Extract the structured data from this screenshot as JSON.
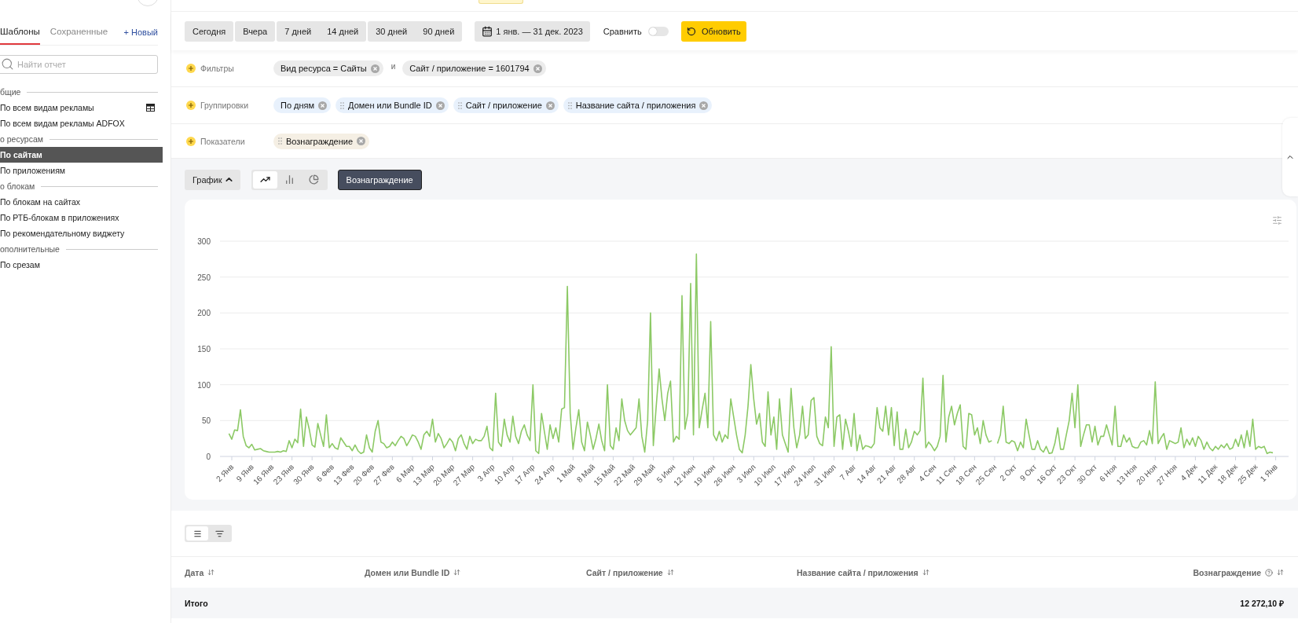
{
  "sidebar": {
    "tabs": [
      {
        "label": "Шаблоны",
        "selected": true
      },
      {
        "label": "Сохраненные",
        "selected": false
      }
    ],
    "new_button": "+ Новый",
    "search": {
      "placeholder": "Найти отчет"
    },
    "sections": [
      {
        "title": "бщие",
        "items": [
          {
            "label": "По всем видам рекламы",
            "selected": false,
            "has_icon": true
          },
          {
            "label": "По всем видам рекламы ADFOX",
            "selected": false,
            "has_icon": false
          }
        ]
      },
      {
        "title": "о ресурсам",
        "items": [
          {
            "label": "По сайтам",
            "selected": true,
            "has_icon": false
          },
          {
            "label": "По приложениям",
            "selected": false,
            "has_icon": false
          }
        ]
      },
      {
        "title": "о блокам",
        "items": [
          {
            "label": "По блокам на сайтах",
            "selected": false,
            "has_icon": false
          },
          {
            "label": "По РТБ-блокам в приложениях",
            "selected": false,
            "has_icon": false
          },
          {
            "label": "По рекомендательному виджету",
            "selected": false,
            "has_icon": false
          }
        ]
      },
      {
        "title": "ополнительные",
        "items": [
          {
            "label": "По срезам",
            "selected": false,
            "has_icon": false
          }
        ]
      }
    ]
  },
  "toolbar": {
    "period_groups": [
      {
        "items": [
          {
            "label": "Сегодня",
            "selected": false
          }
        ]
      },
      {
        "items": [
          {
            "label": "Вчера",
            "selected": false
          }
        ]
      },
      {
        "items": [
          {
            "label": "7 дней",
            "selected": false
          },
          {
            "label": "14 дней",
            "selected": false
          }
        ]
      },
      {
        "items": [
          {
            "label": "30 дней",
            "selected": false
          },
          {
            "label": "90 дней",
            "selected": false
          }
        ]
      }
    ],
    "date_range": "1 янв. — 31 дек. 2023",
    "compare": {
      "label": "Сравнить",
      "on": false
    },
    "refresh_button": "Обновить"
  },
  "parameters": [
    {
      "label": "Фильтры",
      "kind": "filter",
      "items": [
        {
          "kind": "chip",
          "label": "Вид ресурса = Сайты",
          "handle": false
        },
        {
          "kind": "text",
          "label": "и"
        },
        {
          "kind": "chip",
          "label": "Сайт / приложение = 1601794",
          "handle": false
        }
      ]
    },
    {
      "label": "Группировки",
      "kind": "grouping",
      "items": [
        {
          "kind": "chip",
          "label": "По дням",
          "handle": false
        },
        {
          "kind": "chip",
          "label": "Домен или Bundle ID",
          "handle": true
        },
        {
          "kind": "chip",
          "label": "Сайт / приложение",
          "handle": true
        },
        {
          "kind": "chip",
          "label": "Название сайта / приложения",
          "handle": true
        }
      ]
    },
    {
      "label": "Показатели",
      "kind": "metric",
      "items": [
        {
          "kind": "chip",
          "label": "Вознаграждение",
          "handle": true
        }
      ]
    }
  ],
  "chart_controls": {
    "view_button": "График",
    "chart_types": [
      {
        "kind": "line",
        "selected": true
      },
      {
        "kind": "bar",
        "selected": false
      },
      {
        "kind": "pie",
        "selected": false
      }
    ]
  },
  "chart": {
    "chart_data": {
      "type": "line",
      "grid": true,
      "ylim": [
        0,
        300
      ],
      "yticks": [
        0,
        50,
        100,
        150,
        200,
        250,
        300
      ],
      "categories": [
        null,
        "2 Янв",
        null,
        null,
        null,
        null,
        null,
        null,
        "9 Янв",
        null,
        null,
        null,
        null,
        null,
        null,
        "16 Янв",
        null,
        null,
        null,
        null,
        null,
        null,
        "23 Янв",
        null,
        null,
        null,
        null,
        null,
        null,
        "30 Янв",
        null,
        null,
        null,
        null,
        null,
        null,
        "6 Фев",
        null,
        null,
        null,
        null,
        null,
        null,
        "13 Фев",
        null,
        null,
        null,
        null,
        null,
        null,
        "20 Фев",
        null,
        null,
        null,
        null,
        null,
        null,
        "27 Фев",
        null,
        null,
        null,
        null,
        null,
        null,
        "6 Мар",
        null,
        null,
        null,
        null,
        null,
        null,
        "13 Мар",
        null,
        null,
        null,
        null,
        null,
        null,
        "20 Мар",
        null,
        null,
        null,
        null,
        null,
        null,
        "27 Мар",
        null,
        null,
        null,
        null,
        null,
        null,
        "3 Апр",
        null,
        null,
        null,
        null,
        null,
        null,
        "10 Апр",
        null,
        null,
        null,
        null,
        null,
        null,
        "17 Апр",
        null,
        null,
        null,
        null,
        null,
        null,
        "24 Апр",
        null,
        null,
        null,
        null,
        null,
        null,
        "1 Май",
        null,
        null,
        null,
        null,
        null,
        null,
        "8 Май",
        null,
        null,
        null,
        null,
        null,
        null,
        "15 Май",
        null,
        null,
        null,
        null,
        null,
        null,
        "22 Май",
        null,
        null,
        null,
        null,
        null,
        null,
        "29 Май",
        null,
        null,
        null,
        null,
        null,
        null,
        "5 Июн",
        null,
        null,
        null,
        null,
        null,
        null,
        "12 Июн",
        null,
        null,
        null,
        null,
        null,
        null,
        "19 Июн",
        null,
        null,
        null,
        null,
        null,
        null,
        "26 Июн",
        null,
        null,
        null,
        null,
        null,
        null,
        "3 Июл",
        null,
        null,
        null,
        null,
        null,
        null,
        "10 Июл",
        null,
        null,
        null,
        null,
        null,
        null,
        "17 Июл",
        null,
        null,
        null,
        null,
        null,
        null,
        "24 Июл",
        null,
        null,
        null,
        null,
        null,
        null,
        "31 Июл",
        null,
        null,
        null,
        null,
        null,
        null,
        "7 Авг",
        null,
        null,
        null,
        null,
        null,
        null,
        "14 Авг",
        null,
        null,
        null,
        null,
        null,
        null,
        "21 Авг",
        null,
        null,
        null,
        null,
        null,
        null,
        "28 Авг",
        null,
        null,
        null,
        null,
        null,
        null,
        "4 Сен",
        null,
        null,
        null,
        null,
        null,
        null,
        "11 Сен",
        null,
        null,
        null,
        null,
        null,
        null,
        "18 Сен",
        null,
        null,
        null,
        null,
        null,
        null,
        "25 Сен",
        null,
        null,
        null,
        null,
        null,
        null,
        "2 Окт",
        null,
        null,
        null,
        null,
        null,
        null,
        "9 Окт",
        null,
        null,
        null,
        null,
        null,
        null,
        "16 Окт",
        null,
        null,
        null,
        null,
        null,
        null,
        "23 Окт",
        null,
        null,
        null,
        null,
        null,
        null,
        "30 Окт",
        null,
        null,
        null,
        null,
        null,
        null,
        "6 Ноя",
        null,
        null,
        null,
        null,
        null,
        null,
        "13 Ноя",
        null,
        null,
        null,
        null,
        null,
        null,
        "20 Ноя",
        null,
        null,
        null,
        null,
        null,
        null,
        "27 Ноя",
        null,
        null,
        null,
        null,
        null,
        null,
        "4 Дек",
        null,
        null,
        null,
        null,
        null,
        null,
        "11 Дек",
        null,
        null,
        null,
        null,
        null,
        null,
        "18 Дек",
        null,
        null,
        null,
        null,
        null,
        null,
        "25 Дек",
        null,
        null,
        null,
        null,
        null,
        null,
        "1 Янв"
      ],
      "series": [
        {
          "name": "Вознаграждение",
          "color": "#8cc965",
          "values": [
            32,
            24,
            37,
            36,
            65,
            28,
            15,
            12,
            17,
            9,
            10,
            11,
            8,
            7,
            6,
            6,
            6,
            7,
            6,
            8,
            7,
            22,
            12,
            24,
            19,
            66,
            14,
            55,
            38,
            16,
            13,
            46,
            30,
            14,
            58,
            12,
            18,
            12,
            10,
            26,
            20,
            14,
            14,
            8,
            16,
            8,
            4,
            6,
            30,
            12,
            6,
            35,
            50,
            20,
            18,
            12,
            14,
            20,
            15,
            22,
            28,
            25,
            15,
            22,
            30,
            28,
            20,
            10,
            30,
            35,
            28,
            52,
            20,
            32,
            25,
            12,
            18,
            25,
            20,
            8,
            25,
            30,
            18,
            10,
            28,
            18,
            24,
            22,
            22,
            28,
            42,
            12,
            8,
            88,
            20,
            14,
            52,
            30,
            20,
            56,
            28,
            18,
            35,
            44,
            30,
            22,
            100,
            8,
            4,
            60,
            35,
            10,
            44,
            25,
            40,
            20,
            66,
            68,
            237,
            60,
            10,
            40,
            65,
            20,
            8,
            48,
            30,
            10,
            25,
            45,
            22,
            8,
            100,
            15,
            10,
            40,
            22,
            80,
            50,
            36,
            30,
            35,
            40,
            80,
            28,
            6,
            50,
            200,
            15,
            70,
            122,
            80,
            50,
            88,
            105,
            20,
            28,
            24,
            224,
            38,
            60,
            241,
            30,
            282,
            40,
            65,
            88,
            40,
            188,
            30,
            22,
            35,
            20,
            30,
            25,
            80,
            55,
            30,
            10,
            5,
            30,
            70,
            128,
            80,
            45,
            60,
            20,
            14,
            90,
            30,
            55,
            10,
            80,
            30,
            18,
            6,
            95,
            40,
            12,
            30,
            70,
            25,
            30,
            78,
            82,
            28,
            18,
            15,
            55,
            40,
            153,
            14,
            55,
            58,
            10,
            52,
            35,
            14,
            60,
            8,
            30,
            10,
            15,
            14,
            12,
            18,
            68,
            40,
            35,
            70,
            30,
            68,
            15,
            62,
            10,
            10,
            38,
            12,
            20,
            35,
            30,
            36,
            109,
            12,
            20,
            15,
            8,
            14,
            28,
            113,
            20,
            55,
            70,
            44,
            60,
            72,
            14,
            10,
            60,
            58,
            30,
            40,
            18,
            50,
            30,
            20,
            22,
            null,
            18,
            30,
            70,
            20,
            18,
            22,
            20,
            8,
            20,
            12,
            52,
            30,
            10,
            10,
            22,
            10,
            6,
            14,
            4,
            5,
            18,
            40,
            10,
            10,
            30,
            50,
            88,
            40,
            100,
            14,
            30,
            44,
            44,
            20,
            42,
            16,
            28,
            28,
            44,
            30,
            16,
            70,
            14,
            14,
            30,
            20,
            26,
            14,
            12,
            12,
            20,
            22,
            16,
            36,
            18,
            104,
            18,
            26,
            32,
            10,
            22,
            20,
            18,
            20,
            40,
            12,
            24,
            16,
            26,
            14,
            28,
            22,
            10,
            20,
            12,
            8,
            14,
            10,
            16,
            12,
            18,
            10,
            12,
            24,
            14,
            30,
            12,
            36,
            14,
            52,
            10,
            14,
            12,
            14,
            4,
            6,
            5,
            null
          ]
        }
      ]
    }
  },
  "table": {
    "view_modes": [
      {
        "kind": "flat",
        "selected": true
      },
      {
        "kind": "tree",
        "selected": false
      }
    ],
    "columns": [
      {
        "label": "Дата",
        "help": false
      },
      {
        "label": "Домен или Bundle ID",
        "help": false
      },
      {
        "label": "Сайт / приложение",
        "help": false
      },
      {
        "label": "Название сайта / приложения",
        "help": false
      },
      {
        "label": "Вознаграждение",
        "help": true
      }
    ],
    "total": {
      "label": "Итого",
      "value": "12 272,10 ₽"
    }
  }
}
